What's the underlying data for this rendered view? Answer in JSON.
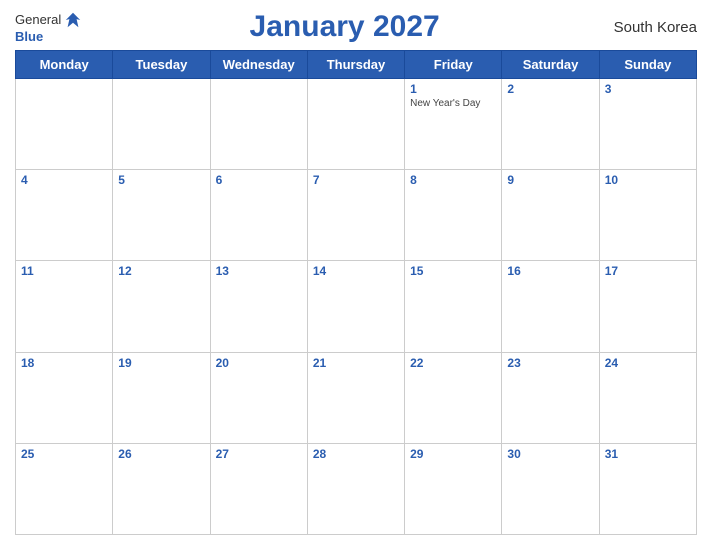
{
  "header": {
    "logo_general": "General",
    "logo_blue": "Blue",
    "title": "January 2027",
    "country": "South Korea"
  },
  "calendar": {
    "weekdays": [
      "Monday",
      "Tuesday",
      "Wednesday",
      "Thursday",
      "Friday",
      "Saturday",
      "Sunday"
    ],
    "weeks": [
      [
        {
          "day": "",
          "holiday": ""
        },
        {
          "day": "",
          "holiday": ""
        },
        {
          "day": "",
          "holiday": ""
        },
        {
          "day": "",
          "holiday": ""
        },
        {
          "day": "1",
          "holiday": "New Year's Day"
        },
        {
          "day": "2",
          "holiday": ""
        },
        {
          "day": "3",
          "holiday": ""
        }
      ],
      [
        {
          "day": "4",
          "holiday": ""
        },
        {
          "day": "5",
          "holiday": ""
        },
        {
          "day": "6",
          "holiday": ""
        },
        {
          "day": "7",
          "holiday": ""
        },
        {
          "day": "8",
          "holiday": ""
        },
        {
          "day": "9",
          "holiday": ""
        },
        {
          "day": "10",
          "holiday": ""
        }
      ],
      [
        {
          "day": "11",
          "holiday": ""
        },
        {
          "day": "12",
          "holiday": ""
        },
        {
          "day": "13",
          "holiday": ""
        },
        {
          "day": "14",
          "holiday": ""
        },
        {
          "day": "15",
          "holiday": ""
        },
        {
          "day": "16",
          "holiday": ""
        },
        {
          "day": "17",
          "holiday": ""
        }
      ],
      [
        {
          "day": "18",
          "holiday": ""
        },
        {
          "day": "19",
          "holiday": ""
        },
        {
          "day": "20",
          "holiday": ""
        },
        {
          "day": "21",
          "holiday": ""
        },
        {
          "day": "22",
          "holiday": ""
        },
        {
          "day": "23",
          "holiday": ""
        },
        {
          "day": "24",
          "holiday": ""
        }
      ],
      [
        {
          "day": "25",
          "holiday": ""
        },
        {
          "day": "26",
          "holiday": ""
        },
        {
          "day": "27",
          "holiday": ""
        },
        {
          "day": "28",
          "holiday": ""
        },
        {
          "day": "29",
          "holiday": ""
        },
        {
          "day": "30",
          "holiday": ""
        },
        {
          "day": "31",
          "holiday": ""
        }
      ]
    ]
  }
}
